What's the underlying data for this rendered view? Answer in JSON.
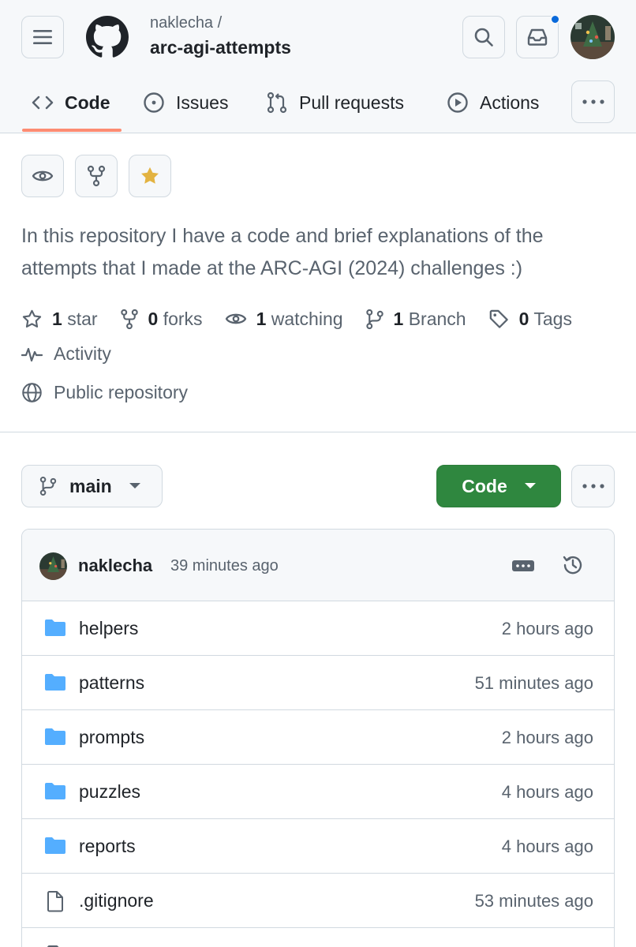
{
  "header": {
    "owner": "naklecha /",
    "repo": "arc-agi-attempts",
    "has_notification": true
  },
  "tabs": [
    {
      "label": "Code",
      "icon": "code-icon",
      "active": true
    },
    {
      "label": "Issues",
      "icon": "issue-opened-icon"
    },
    {
      "label": "Pull requests",
      "icon": "git-pull-request-icon"
    },
    {
      "label": "Actions",
      "icon": "play-icon"
    }
  ],
  "repo_actions": {
    "watch_icon": "eye-icon",
    "fork_icon": "repo-forked-icon",
    "star_icon": "star-fill-icon",
    "star_color": "#e3b341"
  },
  "description": "In this repository I have a code and brief explanations of the attempts that I made at the ARC-AGI (2024) challenges :)",
  "stats": {
    "stars_count": "1",
    "stars_label": "star",
    "forks_count": "0",
    "forks_label": "forks",
    "watching_count": "1",
    "watching_label": "watching",
    "branch_count": "1",
    "branch_label": "Branch",
    "tags_count": "0",
    "tags_label": "Tags"
  },
  "activity_label": "Activity",
  "visibility_label": "Public repository",
  "branch": {
    "name": "main"
  },
  "code_button": {
    "label": "Code",
    "color": "#2f873f"
  },
  "latest_commit": {
    "user": "naklecha",
    "time": "39 minutes ago"
  },
  "files": [
    {
      "type": "folder",
      "name": "helpers",
      "updated": "2 hours ago"
    },
    {
      "type": "folder",
      "name": "patterns",
      "updated": "51 minutes ago"
    },
    {
      "type": "folder",
      "name": "prompts",
      "updated": "2 hours ago"
    },
    {
      "type": "folder",
      "name": "puzzles",
      "updated": "4 hours ago"
    },
    {
      "type": "folder",
      "name": "reports",
      "updated": "4 hours ago"
    },
    {
      "type": "file",
      "name": ".gitignore",
      "updated": "53 minutes ago"
    }
  ],
  "colors": {
    "folder": "#54aeff",
    "tab_underline": "#fd8c73",
    "muted_text": "#59636e",
    "notification": "#0969da"
  }
}
